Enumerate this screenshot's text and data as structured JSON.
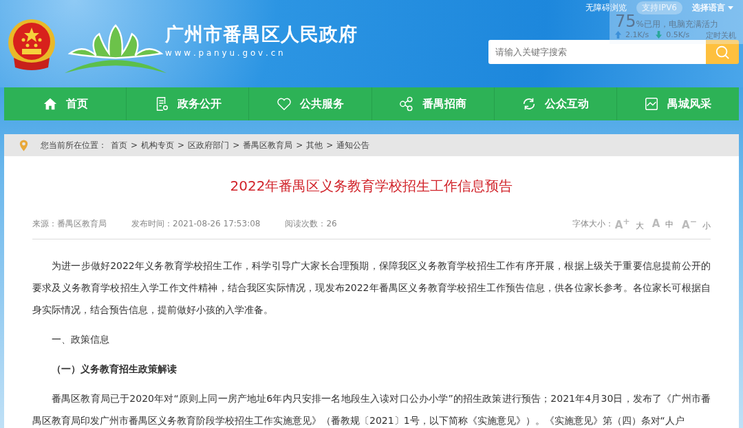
{
  "header": {
    "top_links": [
      "无障碍浏览",
      "支持IPV6",
      "选择语言"
    ],
    "site_title": "广州市番禺区人民政府",
    "site_url": "w w w . p a n y u . g o v . c n",
    "search": {
      "placeholder": "请输入关键字搜索"
    }
  },
  "monitor_widget": {
    "percent": "75",
    "status": "%已用，电脑充满活力",
    "upload": "2.1K/s",
    "download": "0.5K/s",
    "action": "定时关机"
  },
  "nav": [
    {
      "label": "首页"
    },
    {
      "label": "政务公开"
    },
    {
      "label": "公共服务"
    },
    {
      "label": "番禺招商"
    },
    {
      "label": "公众互动"
    },
    {
      "label": "禺城风采"
    }
  ],
  "breadcrumb": {
    "prefix": "您当前所在位置：",
    "separator": ">",
    "items": [
      "首页",
      "机构专页",
      "区政府部门",
      "番禺区教育局",
      "其他",
      "通知公告"
    ]
  },
  "article": {
    "title": "2022年番禺区义务教育学校招生工作信息预告",
    "meta": [
      "来源：番禺区教育局",
      "发布时间：2021-08-26 17:53:08",
      "阅读次数：26"
    ],
    "font_size": {
      "label": "字体大小：",
      "options": [
        {
          "glyph": "A$^{+}$",
          "label": "大"
        },
        {
          "glyph": "A",
          "label": "中"
        },
        {
          "glyph": "A$^{−}$",
          "label": "小"
        }
      ]
    },
    "paragraphs": [
      {
        "kind": "body",
        "text": "为进一步做好2022年义务教育学校招生工作，科学引导广大家长合理预期，保障我区义务教育学校招生工作有序开展，根据上级关于重要信息提前公开的要求及义务教育学校招生入学工作文件精神，结合我区实际情况，现发布2022年番禺区义务教育学校招生工作预告信息，供各位家长参考。各位家长可根据自身实际情况，结合预告信息，提前做好小孩的入学准备。"
      },
      {
        "kind": "heading",
        "text": "一、政策信息"
      },
      {
        "kind": "subheading",
        "text": "（一）义务教育招生政策解读"
      },
      {
        "kind": "body",
        "text": "番禺区教育局已于2020年对“原则上同一房产地址6年内只安排一名地段生入读对口公办小学”的招生政策进行预告；2021年4月30日，发布了《广州市番禺区教育局印发广州市番禺区义务教育阶段学校招生工作实施意见》（番教规〔2021〕1号，以下简称《实施意见》）。《实施意见》第（四）条对“人户"
      }
    ]
  }
}
